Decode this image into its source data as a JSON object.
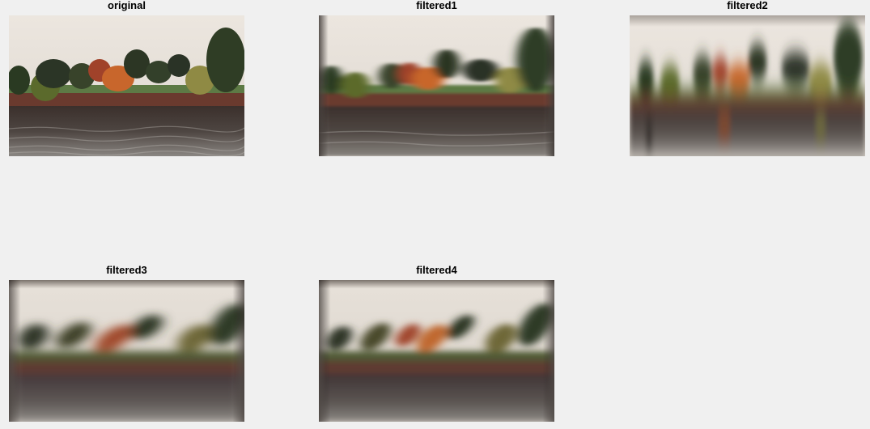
{
  "figure": {
    "panels": [
      {
        "title": "original",
        "image": "lake-landscape-original"
      },
      {
        "title": "filtered1",
        "image": "lake-landscape-horizontal-motion-blur"
      },
      {
        "title": "filtered2",
        "image": "lake-landscape-strong-horizontal-blur"
      },
      {
        "title": "filtered3",
        "image": "lake-landscape-diagonal-motion-blur"
      },
      {
        "title": "filtered4",
        "image": "lake-landscape-diagonal-motion-blur-2"
      }
    ]
  }
}
